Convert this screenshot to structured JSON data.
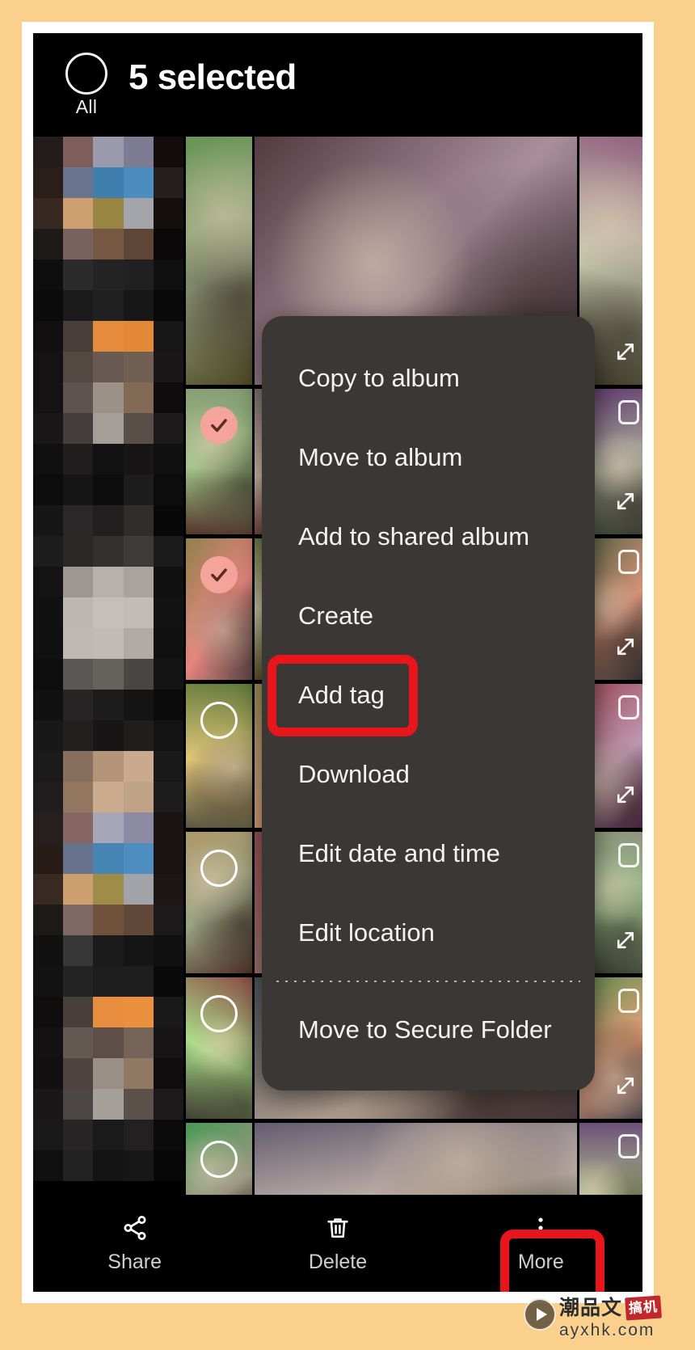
{
  "app": {
    "background_color": "#fbd08d",
    "frame_color": "#ffffff",
    "screen_color": "#000000"
  },
  "header": {
    "select_all_label": "All",
    "title": "5 selected"
  },
  "menu": {
    "background_color": "#3a3735",
    "items": [
      {
        "label": "Copy to album",
        "highlighted": false
      },
      {
        "label": "Move to album",
        "highlighted": false
      },
      {
        "label": "Add to shared album",
        "highlighted": false
      },
      {
        "label": "Create",
        "highlighted": true
      },
      {
        "label": "Add tag",
        "highlighted": false
      },
      {
        "label": "Download",
        "highlighted": false
      },
      {
        "label": "Edit date and time",
        "highlighted": false
      },
      {
        "label": "Edit location",
        "highlighted": false
      },
      {
        "label": "Move to Secure Folder",
        "highlighted": false
      }
    ],
    "divider_after_index": 7
  },
  "bottom_bar": {
    "items": [
      {
        "label": "Share",
        "icon": "share-icon",
        "highlighted": false
      },
      {
        "label": "Delete",
        "icon": "trash-icon",
        "highlighted": false
      },
      {
        "label": "More",
        "icon": "more-dots-icon",
        "highlighted": true
      }
    ]
  },
  "annotations": {
    "highlight_color": "#e8161c",
    "boxes": [
      {
        "target": "Create",
        "shape": "rounded-rect"
      },
      {
        "target": "More",
        "shape": "rounded-rect"
      }
    ]
  },
  "gallery": {
    "selected_count": 5,
    "selection_check_color": "#f4a49b",
    "thumbnails": [
      {
        "column": "mid",
        "selected": true
      },
      {
        "column": "mid",
        "selected": true
      },
      {
        "column": "mid",
        "selected": false
      },
      {
        "column": "mid",
        "selected": false
      },
      {
        "column": "mid",
        "selected": false
      },
      {
        "column": "mid",
        "selected": false
      }
    ]
  },
  "watermark": {
    "cn_text": "潮品文",
    "stamp_text": "搞机",
    "url": "ayxhk.com",
    "play_icon": "play-icon"
  }
}
